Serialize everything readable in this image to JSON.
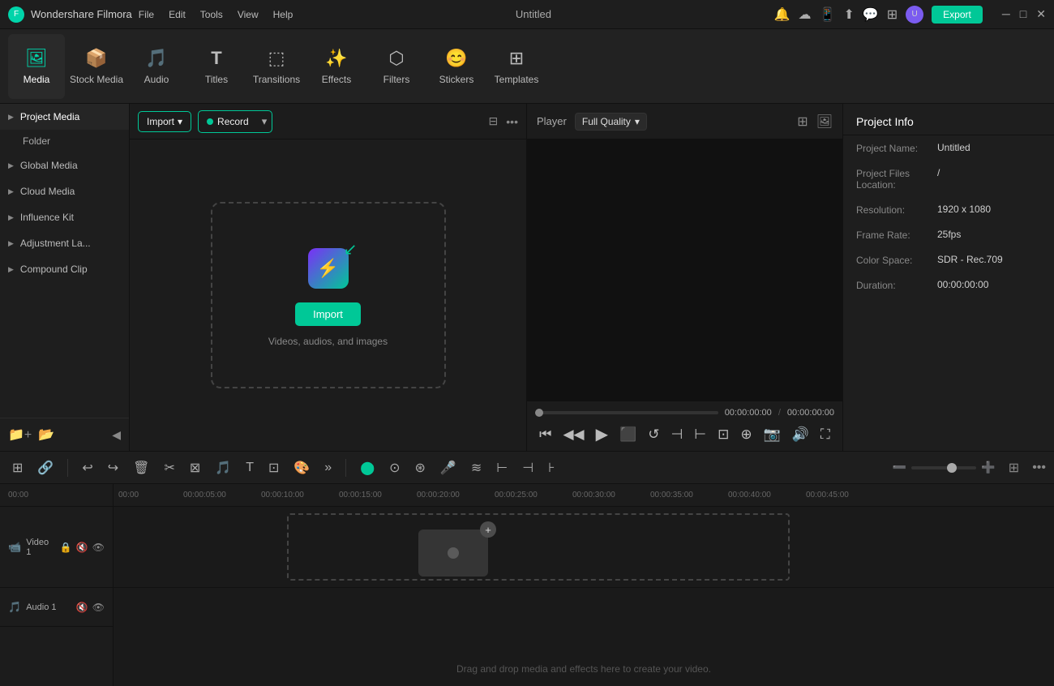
{
  "app": {
    "name": "Wondershare Filmora",
    "title": "Untitled",
    "export_label": "Export"
  },
  "menus": [
    "File",
    "Edit",
    "Tools",
    "View",
    "Help"
  ],
  "toolbar": {
    "items": [
      {
        "id": "media",
        "label": "Media",
        "icon": "🖼",
        "active": true
      },
      {
        "id": "stock-media",
        "label": "Stock Media",
        "icon": "📦",
        "active": false
      },
      {
        "id": "audio",
        "label": "Audio",
        "icon": "🎵",
        "active": false
      },
      {
        "id": "titles",
        "label": "Titles",
        "icon": "T",
        "active": false
      },
      {
        "id": "transitions",
        "label": "Transitions",
        "icon": "⬚",
        "active": false
      },
      {
        "id": "effects",
        "label": "Effects",
        "icon": "✨",
        "active": false
      },
      {
        "id": "filters",
        "label": "Filters",
        "icon": "⬡",
        "active": false
      },
      {
        "id": "stickers",
        "label": "Stickers",
        "icon": "😊",
        "active": false
      },
      {
        "id": "templates",
        "label": "Templates",
        "icon": "⊞",
        "active": false
      }
    ]
  },
  "sidebar": {
    "items": [
      {
        "id": "project-media",
        "label": "Project Media",
        "active": true
      },
      {
        "id": "folder",
        "label": "Folder",
        "sub": true
      },
      {
        "id": "global-media",
        "label": "Global Media",
        "active": false
      },
      {
        "id": "cloud-media",
        "label": "Cloud Media",
        "active": false
      },
      {
        "id": "influence-kit",
        "label": "Influence Kit",
        "active": false
      },
      {
        "id": "adjustment-la",
        "label": "Adjustment La...",
        "active": false
      },
      {
        "id": "compound-clip",
        "label": "Compound Clip",
        "active": false
      }
    ],
    "bottom_icons": [
      "folder-plus",
      "folder-open"
    ],
    "collapse_icon": "◀"
  },
  "media_panel": {
    "import_label": "Import",
    "import_arrow": "▾",
    "record_label": "Record",
    "record_arrow": "▾",
    "filter_icon": "⊟",
    "more_icon": "…",
    "import_area": {
      "button_label": "Import",
      "subtitle": "Videos, audios, and images"
    }
  },
  "player": {
    "label": "Player",
    "quality": "Full Quality",
    "time_current": "00:00:00:00",
    "time_sep": "/",
    "time_total": "00:00:00:00"
  },
  "project_info": {
    "title": "Project Info",
    "rows": [
      {
        "label": "Project Name:",
        "value": "Untitled"
      },
      {
        "label": "Project Files Location:",
        "value": "/"
      },
      {
        "label": "Resolution:",
        "value": "1920 x 1080"
      },
      {
        "label": "Frame Rate:",
        "value": "25fps"
      },
      {
        "label": "Color Space:",
        "value": "SDR - Rec.709"
      },
      {
        "label": "Duration:",
        "value": "00:00:00:00"
      }
    ]
  },
  "timeline": {
    "ruler_marks": [
      "00:00",
      "00:00:05:00",
      "00:00:10:00",
      "00:00:15:00",
      "00:00:20:00",
      "00:00:25:00",
      "00:00:30:00",
      "00:00:35:00",
      "00:00:40:00",
      "00:00:45:00"
    ],
    "tracks": [
      {
        "id": "video-1",
        "label": "Video 1",
        "type": "video",
        "icons": [
          "🔒",
          "👁"
        ]
      },
      {
        "id": "audio-1",
        "label": "Audio 1",
        "type": "audio",
        "icons": [
          "🔇",
          "👁"
        ]
      }
    ],
    "drag_hint": "Drag and drop media and effects here to create your video."
  }
}
